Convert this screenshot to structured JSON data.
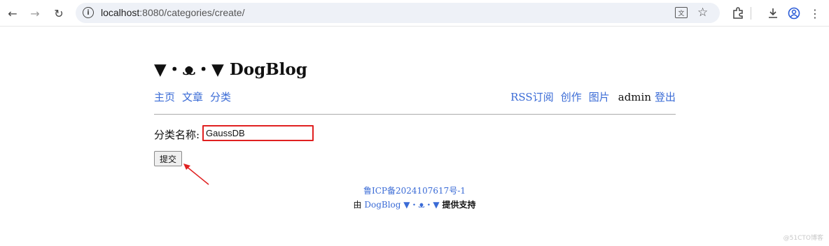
{
  "browser": {
    "url_host": "localhost",
    "url_path": ":8080/categories/create/",
    "icons": [
      "back-icon",
      "forward-icon",
      "reload-icon",
      "site-info-icon",
      "translate-icon",
      "star-icon",
      "extensions-icon",
      "download-icon",
      "profile-icon",
      "menu-icon"
    ]
  },
  "site": {
    "title": "▼・ᴥ・▼ DogBlog"
  },
  "nav": {
    "left": [
      "主页",
      "文章",
      "分类"
    ],
    "right": [
      "RSS订阅",
      "创作",
      "图片"
    ],
    "user": "admin",
    "logout": "登出"
  },
  "form": {
    "label": "分类名称:",
    "value": "GaussDB",
    "submit": "提交"
  },
  "footer": {
    "icp": "鲁ICP备2024107617号-1",
    "prefix": "由",
    "brand": "DogBlog ▼・ᴥ・▼",
    "suffix": "提供支持"
  },
  "watermark": "@51CTO博客",
  "colors": {
    "link": "#3a6bd6",
    "highlight_border": "#e02020",
    "annotation_arrow": "#e02020"
  }
}
